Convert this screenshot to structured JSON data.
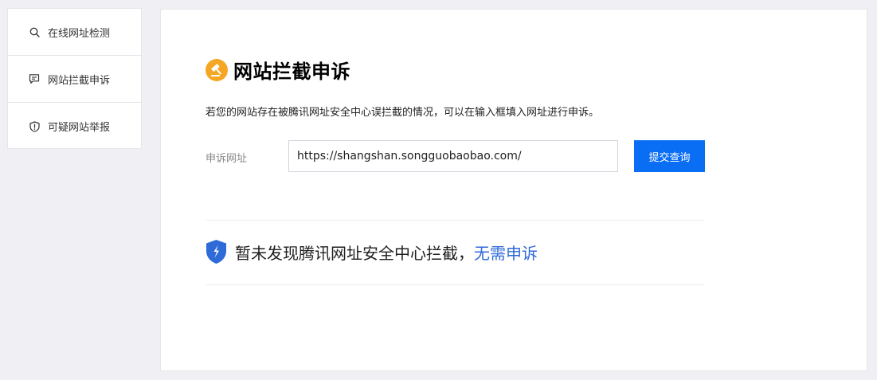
{
  "sidebar": {
    "items": [
      {
        "label": "在线网址检测",
        "icon": "search-icon"
      },
      {
        "label": "网站拦截申诉",
        "icon": "chat-icon"
      },
      {
        "label": "可疑网站举报",
        "icon": "shield-alert-icon"
      }
    ]
  },
  "main": {
    "title": "网站拦截申诉",
    "title_icon": "gavel-icon",
    "description": "若您的网站存在被腾讯网址安全中心误拦截的情况，可以在输入框填入网址进行申诉。",
    "form": {
      "label": "申诉网址",
      "url_value": "https://shangshan.songguobaobao.com/",
      "submit_label": "提交查询"
    },
    "result": {
      "icon": "shield-check-icon",
      "text": "暂未发现腾讯网址安全中心拦截，",
      "link_text": "无需申诉"
    }
  },
  "colors": {
    "accent": "#0a6ef5",
    "title_icon": "#f5a623",
    "shield": "#2f6bd8",
    "link": "#2f6bd8"
  }
}
